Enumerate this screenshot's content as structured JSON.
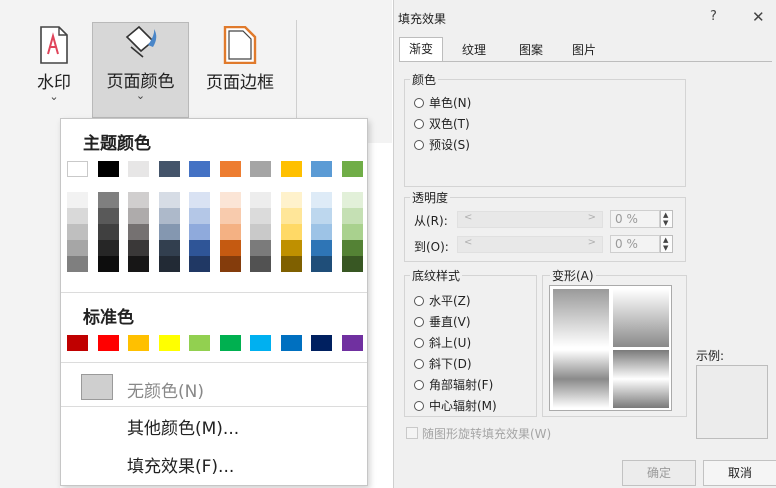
{
  "ribbon": {
    "watermark": {
      "label": "水印",
      "icon": "watermark-icon"
    },
    "page_color": {
      "label": "页面颜色",
      "icon": "page-color-icon"
    },
    "page_border": {
      "label": "页面边框",
      "icon": "page-border-icon"
    },
    "chevron": "⌄"
  },
  "dropdown": {
    "theme_colors_title": "主题颜色",
    "standard_colors_title": "标准色",
    "no_color": "无颜色(N)",
    "more_colors": "其他颜色(M)...",
    "fill_effects": "填充效果(F)...",
    "theme_top_row": [
      "#ffffff",
      "#000000",
      "#e7e6e6",
      "#44546a",
      "#4472c4",
      "#ed7d31",
      "#a5a5a5",
      "#ffc000",
      "#5b9bd5",
      "#70ad47"
    ],
    "theme_shades": [
      [
        "#f2f2f2",
        "#7f7f7f",
        "#d0cece",
        "#d6dce5",
        "#d9e2f3",
        "#fbe5d6",
        "#ededed",
        "#fff2cc",
        "#deebf7",
        "#e2f0d9"
      ],
      [
        "#d9d9d9",
        "#595959",
        "#aeabab",
        "#adb9ca",
        "#b4c7e7",
        "#f8cbad",
        "#dbdbdb",
        "#ffe699",
        "#bdd7ee",
        "#c5e0b4"
      ],
      [
        "#bfbfbf",
        "#404040",
        "#757171",
        "#8497b0",
        "#8faadc",
        "#f4b183",
        "#c9c9c9",
        "#ffd966",
        "#9dc3e6",
        "#a9d18e"
      ],
      [
        "#a6a6a6",
        "#262626",
        "#3a3838",
        "#323f4f",
        "#2f5597",
        "#c55a11",
        "#7b7b7b",
        "#bf9000",
        "#2e75b6",
        "#548235"
      ],
      [
        "#7f7f7f",
        "#0d0d0d",
        "#171616",
        "#222a35",
        "#203864",
        "#843c0c",
        "#525252",
        "#7f6000",
        "#1f4e79",
        "#385723"
      ]
    ],
    "standard_colors": [
      "#c00000",
      "#ff0000",
      "#ffc000",
      "#ffff00",
      "#92d050",
      "#00b050",
      "#00b0f0",
      "#0070c0",
      "#002060",
      "#7030a0"
    ]
  },
  "dialog": {
    "title": "填充效果",
    "help": "?",
    "close": "✕",
    "tabs": [
      "渐变",
      "纹理",
      "图案",
      "图片"
    ],
    "active_tab": "渐变",
    "colors_group": {
      "label": "颜色",
      "options": [
        "单色(N)",
        "双色(T)",
        "预设(S)"
      ]
    },
    "transparency_group": {
      "label": "透明度",
      "from_label": "从(R):",
      "to_label": "到(O):",
      "from_value": "0 %",
      "to_value": "0 %",
      "slider_left": "<",
      "slider_right": ">"
    },
    "shading_group": {
      "label": "底纹样式",
      "options": [
        "水平(Z)",
        "垂直(V)",
        "斜上(U)",
        "斜下(D)",
        "角部辐射(F)",
        "中心辐射(M)"
      ]
    },
    "variants_label": "变形(A)",
    "sample_label": "示例:",
    "rotate_label": "随图形旋转填充效果(W)",
    "ok_label": "确定",
    "cancel_label": "取消"
  }
}
